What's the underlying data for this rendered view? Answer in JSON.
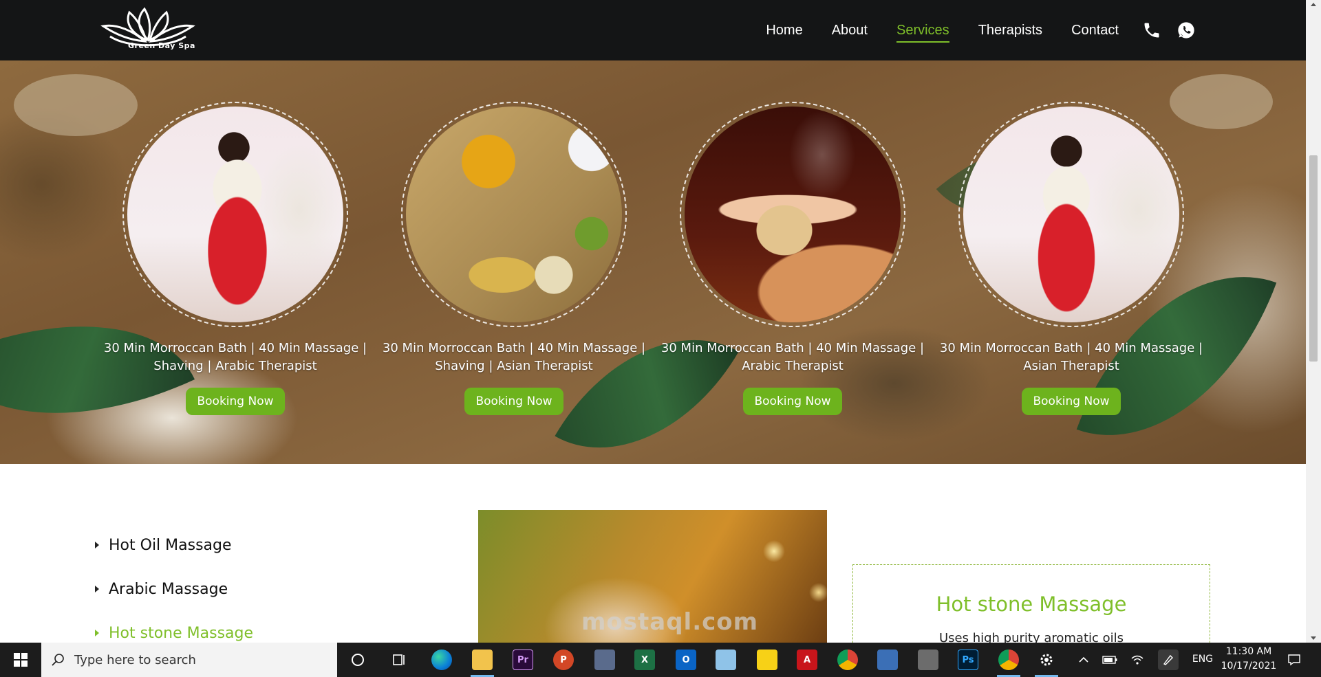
{
  "header": {
    "logo_text": "Green Day Spa",
    "nav": [
      {
        "label": "Home",
        "active": false
      },
      {
        "label": "About",
        "active": false
      },
      {
        "label": "Services",
        "active": true
      },
      {
        "label": "Therapists",
        "active": false
      },
      {
        "label": "Contact",
        "active": false
      }
    ],
    "icons": [
      "phone-icon",
      "whatsapp-icon"
    ]
  },
  "packages": [
    {
      "line1": "30 Min Morroccan Bath | 40 Min Massage |",
      "line2": "Shaving | Arabic Therapist",
      "button": "Booking Now",
      "image": "therapist-photo"
    },
    {
      "line1": "30 Min Morroccan Bath | 40 Min Massage |",
      "line2": "Shaving | Asian Therapist",
      "button": "Booking Now",
      "image": "spices-photo"
    },
    {
      "line1": "30 Min Morroccan Bath | 40 Min Massage |",
      "line2": "Arabic Therapist",
      "button": "Booking Now",
      "image": "massage-towel-photo"
    },
    {
      "line1": "30 Min Morroccan Bath | 40 Min Massage |",
      "line2": "Asian Therapist",
      "button": "Booking Now",
      "image": "therapist-photo"
    }
  ],
  "services": {
    "items": [
      {
        "label": "Hot Oil Massage",
        "active": false
      },
      {
        "label": "Arabic Massage",
        "active": false
      },
      {
        "label": "Hot stone Massage",
        "active": true
      }
    ],
    "detail_title": "Hot stone Massage",
    "detail_text": "Uses high purity aromatic oils"
  },
  "watermark": "mostaql.com",
  "taskbar": {
    "search_placeholder": "Type here to search",
    "language": "ENG",
    "time": "11:30 AM",
    "date": "10/17/2021"
  },
  "colors": {
    "accent": "#7fbf2a",
    "button": "#6db31d",
    "header_bg": "#141516"
  }
}
